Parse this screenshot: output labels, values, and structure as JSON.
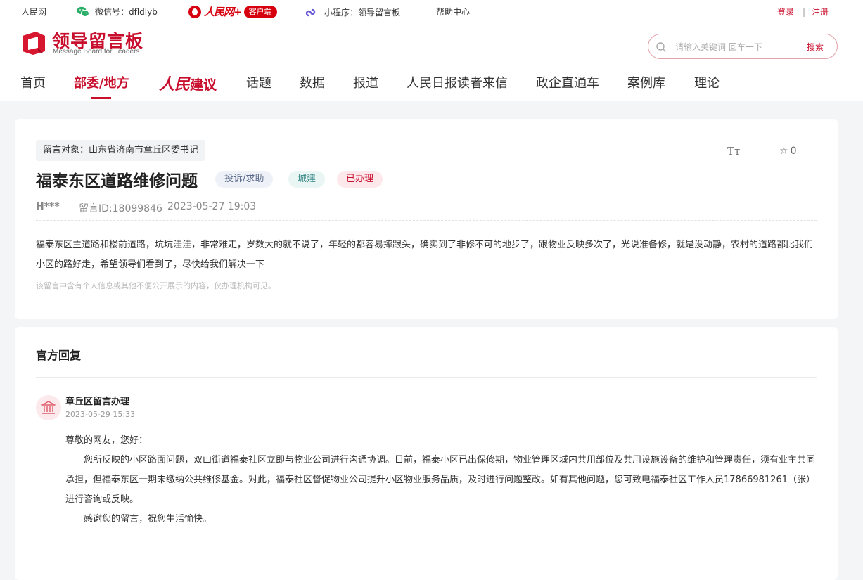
{
  "topbar": {
    "site": "人民网",
    "wechat": "微信号：dfldlyb",
    "rmw_logo": "人民网+",
    "rmw_badge": "客户端",
    "miniprogram": "小程序：领导留言板",
    "help": "帮助中心",
    "login": "登录",
    "separator": "|",
    "register": "注册"
  },
  "logo": {
    "title": "领导留言板",
    "subtitle": "Message Board for Leaders"
  },
  "search": {
    "placeholder": "请输入关键词 回车一下",
    "button": "搜索"
  },
  "nav": {
    "items": [
      {
        "label": "首页"
      },
      {
        "label": "部委/地方"
      },
      {
        "label": "人民建议"
      },
      {
        "label": "话题"
      },
      {
        "label": "数据"
      },
      {
        "label": "报道"
      },
      {
        "label": "人民日报读者来信"
      },
      {
        "label": "政企直通车"
      },
      {
        "label": "案例库"
      },
      {
        "label": "理论"
      }
    ],
    "jianyi_cursive": "人民",
    "jianyi_plain": "建议"
  },
  "message": {
    "target": "留言对象：山东省济南市章丘区委书记",
    "font_icon": "Tт",
    "favorites": "0",
    "title": "福泰东区道路维修问题",
    "tags": {
      "type": "投诉/求助",
      "category": "城建",
      "status": "已办理"
    },
    "author": "H***",
    "id": "留言ID:18099846",
    "date": "2023-05-27 19:03",
    "content": "福泰东区主道路和楼前道路，坑坑洼洼，非常难走，岁数大的就不说了，年轻的都容易摔跟头，确实到了非修不可的地步了，跟物业反映多次了，光说准备修，就是没动静，农村的道路都比我们小区的路好走，希望领导们看到了，尽快给我们解决一下",
    "note": "该留言中含有个人信息或其他不便公开展示的内容，仅办理机构可见。"
  },
  "reply": {
    "heading": "官方回复",
    "org": "章丘区留言办理",
    "time": "2023-05-29 15:33",
    "greeting": "尊敬的网友，您好：",
    "body": "您所反映的小区路面问题，双山街道福泰社区立即与物业公司进行沟通协调。目前，福泰小区已出保修期，物业管理区域内共用部位及共用设施设备的维护和管理责任，须有业主共同承担，但福泰东区一期未缴纳公共维修基金。对此，福泰社区督促物业公司提升小区物业服务品质，及时进行问题整改。如有其他问题，您可致电福泰社区工作人员17866981261（张）进行咨询或反映。",
    "closing": "感谢您的留言，祝您生活愉快。"
  },
  "colors": {
    "brand_red": "#c8102e",
    "background": "#f4f5f7"
  }
}
